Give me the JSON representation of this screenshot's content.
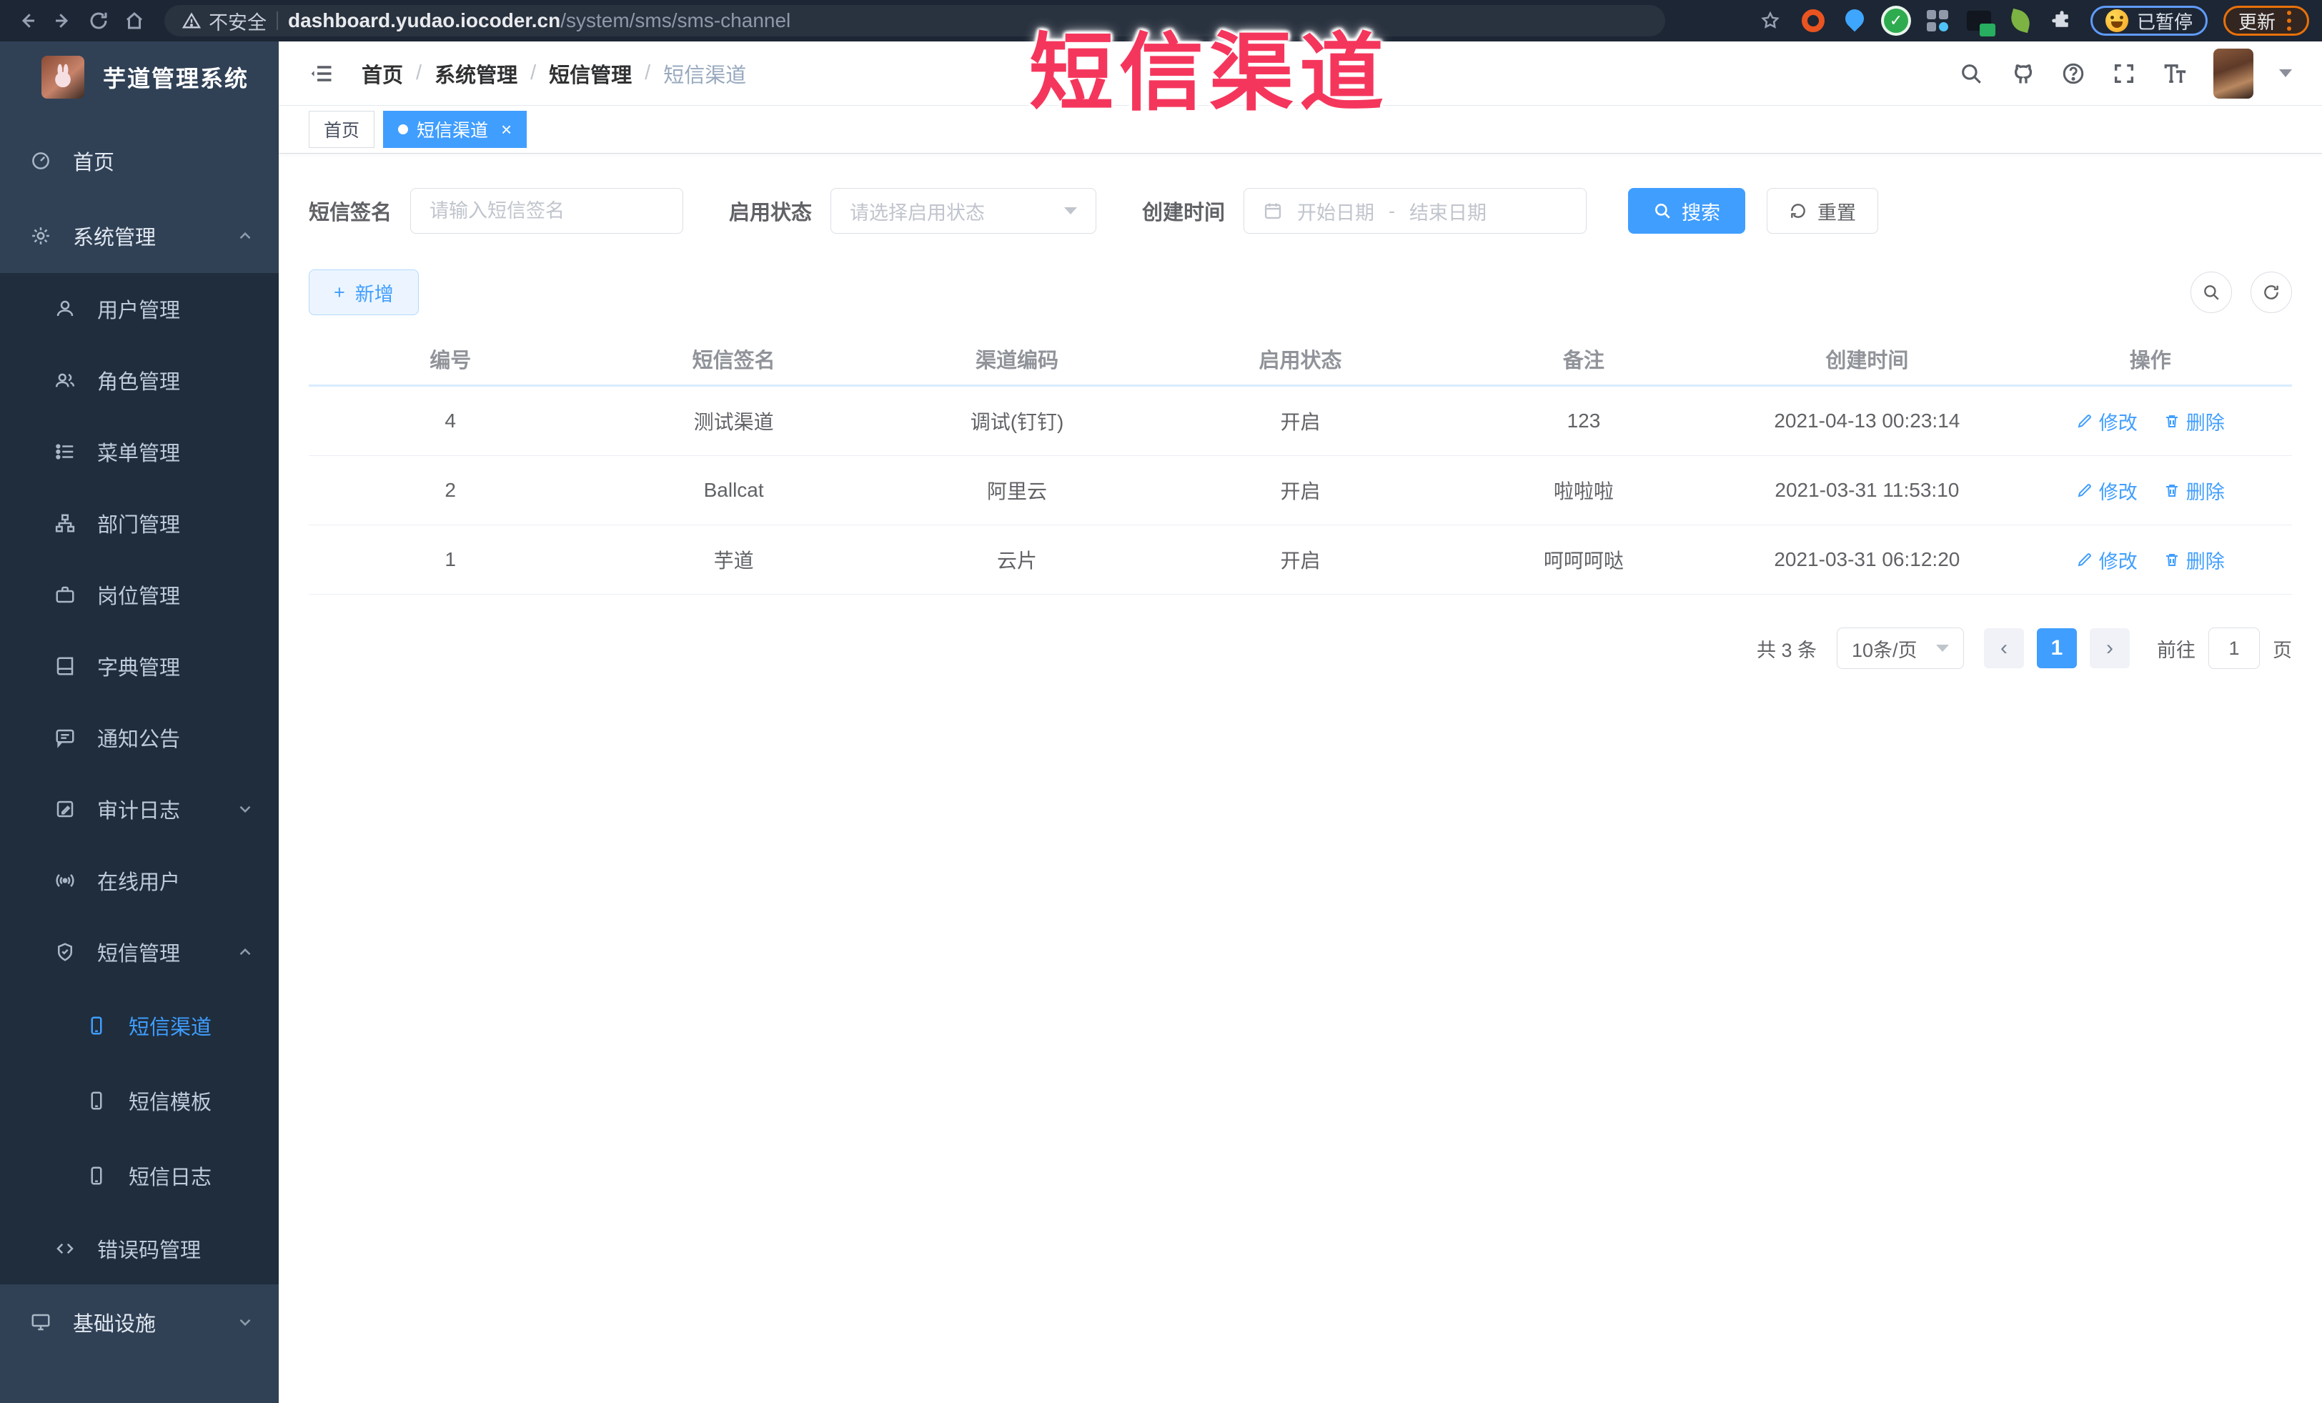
{
  "browser": {
    "security_label": "不安全",
    "url_domain": "dashboard.yudao.iocoder.cn",
    "url_path": "/system/sms/sms-channel",
    "paused_label": "已暂停",
    "update_label": "更新"
  },
  "watermark": "短信渠道",
  "sidebar": {
    "title": "芋道管理系统",
    "items": [
      {
        "label": "首页",
        "level": 1
      },
      {
        "label": "系统管理",
        "level": 1,
        "state": "expanded"
      },
      {
        "label": "用户管理",
        "level": 2
      },
      {
        "label": "角色管理",
        "level": 2
      },
      {
        "label": "菜单管理",
        "level": 2
      },
      {
        "label": "部门管理",
        "level": 2
      },
      {
        "label": "岗位管理",
        "level": 2
      },
      {
        "label": "字典管理",
        "level": 2
      },
      {
        "label": "通知公告",
        "level": 2
      },
      {
        "label": "审计日志",
        "level": 2,
        "state": "collapsed"
      },
      {
        "label": "在线用户",
        "level": 2
      },
      {
        "label": "短信管理",
        "level": 2,
        "state": "expanded"
      },
      {
        "label": "短信渠道",
        "level": 3,
        "active": true
      },
      {
        "label": "短信模板",
        "level": 3
      },
      {
        "label": "短信日志",
        "level": 3
      },
      {
        "label": "错误码管理",
        "level": 2
      },
      {
        "label": "基础设施",
        "level": 1,
        "state": "collapsed"
      }
    ]
  },
  "header": {
    "breadcrumb": [
      "首页",
      "系统管理",
      "短信管理",
      "短信渠道"
    ],
    "separator": "/"
  },
  "tabs": [
    {
      "label": "首页"
    },
    {
      "label": "短信渠道",
      "close": "×",
      "active": true
    }
  ],
  "filters": {
    "sign_label": "短信签名",
    "sign_placeholder": "请输入短信签名",
    "status_label": "启用状态",
    "status_placeholder": "请选择启用状态",
    "date_label": "创建时间",
    "date_start_placeholder": "开始日期",
    "date_separator": "-",
    "date_end_placeholder": "结束日期",
    "search_label": "搜索",
    "reset_label": "重置"
  },
  "toolbar": {
    "plus": "+",
    "add_label": "新增"
  },
  "table": {
    "columns": [
      "编号",
      "短信签名",
      "渠道编码",
      "启用状态",
      "备注",
      "创建时间",
      "操作"
    ],
    "edit_label": "修改",
    "delete_label": "删除",
    "rows": [
      {
        "id": "4",
        "sign": "测试渠道",
        "code": "调试(钉钉)",
        "status": "开启",
        "remark": "123",
        "created": "2021-04-13 00:23:14"
      },
      {
        "id": "2",
        "sign": "Ballcat",
        "code": "阿里云",
        "status": "开启",
        "remark": "啦啦啦",
        "created": "2021-03-31 11:53:10"
      },
      {
        "id": "1",
        "sign": "芋道",
        "code": "云片",
        "status": "开启",
        "remark": "呵呵呵哒",
        "created": "2021-03-31 06:12:20"
      }
    ]
  },
  "pagination": {
    "total": "共 3 条",
    "size": "10条/页",
    "prev": "‹",
    "page": "1",
    "next": "›",
    "goto": "前往",
    "goto_value": "1",
    "unit": "页"
  },
  "colors": {
    "primary": "#409eff",
    "sidebar_bg": "#304156",
    "submenu_bg": "#1f2d3d",
    "browser_bar": "#1d2634",
    "watermark": "#f5365c"
  }
}
